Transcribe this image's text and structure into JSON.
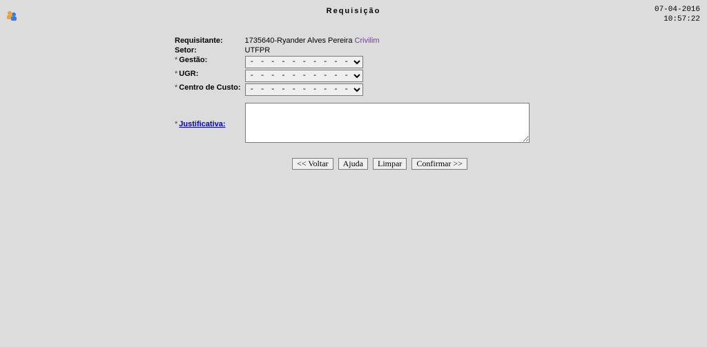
{
  "header": {
    "title": "Requisição",
    "date": "07-04-2016",
    "time": "10:57:22"
  },
  "form": {
    "requisitante_label": "Requisitante:",
    "requisitante_id": "1735640-",
    "requisitante_name": "Ryander Alves Pereira ",
    "requisitante_last": "Crivilim",
    "setor_label": "Setor:",
    "setor_value": "UTFPR",
    "gestao_label": "Gestão:",
    "ugr_label": "UGR:",
    "centro_label": "Centro de Custo:",
    "justificativa_label": "Justificativa:",
    "select_placeholder": "- - - - - - - - - -",
    "justificativa_value": ""
  },
  "buttons": {
    "voltar": "<< Voltar",
    "ajuda": "Ajuda",
    "limpar": "Limpar",
    "confirmar": "Confirmar >>"
  }
}
